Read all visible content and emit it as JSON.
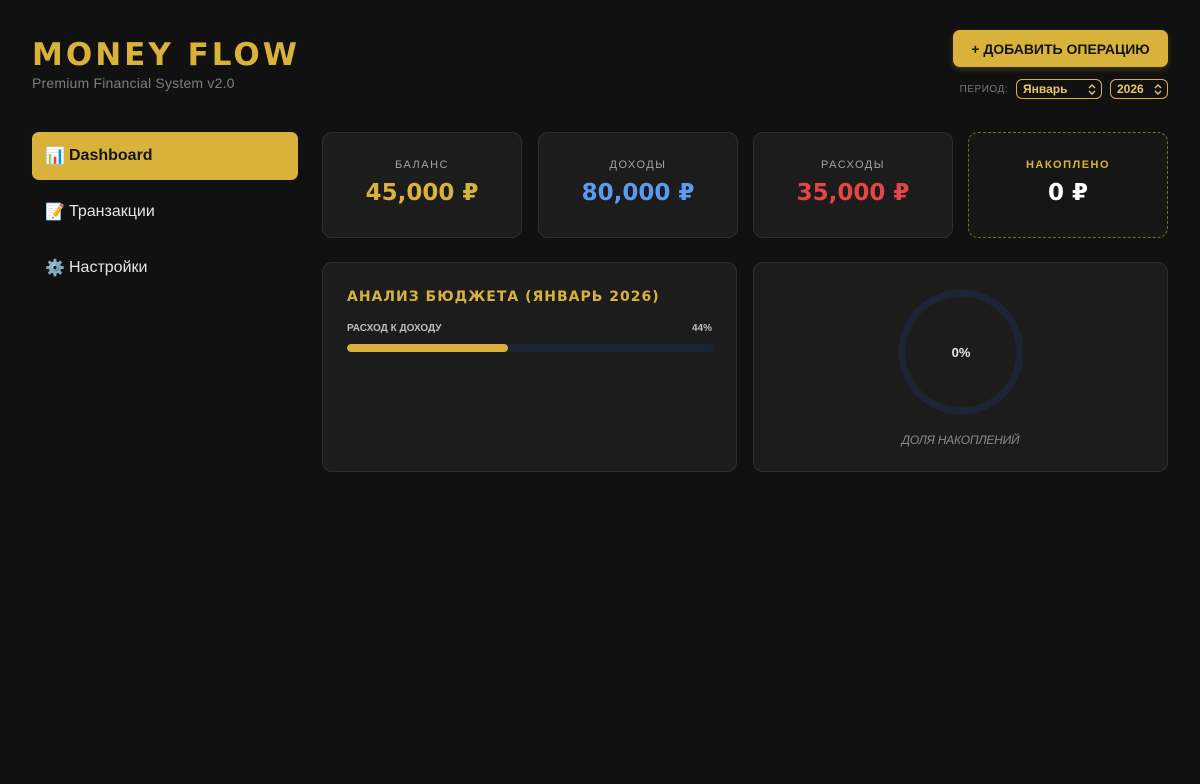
{
  "header": {
    "title": "MONEY FLOW",
    "subtitle": "Premium Financial System v2.0",
    "add_button_label": "+ ДОБАВИТЬ ОПЕРАЦИЮ",
    "period_label": "ПЕРИОД:",
    "month_selected": "Январь",
    "year_selected": "2026"
  },
  "sidebar": {
    "items": [
      {
        "icon": "📊",
        "icon_name": "bar-chart-icon",
        "label": "Dashboard",
        "active": true
      },
      {
        "icon": "📝",
        "icon_name": "memo-icon",
        "label": "Транзакции",
        "active": false
      },
      {
        "icon": "⚙️",
        "icon_name": "gear-icon",
        "label": "Настройки",
        "active": false
      }
    ]
  },
  "stats": {
    "balance": {
      "label": "БАЛАНС",
      "value": "45,000 ₽",
      "color": "#d8b23a"
    },
    "income": {
      "label": "ДОХОДЫ",
      "value": "80,000 ₽",
      "color": "#5b9cf0"
    },
    "expense": {
      "label": "РАСХОДЫ",
      "value": "35,000 ₽",
      "color": "#e64545"
    },
    "savings": {
      "label": "НАКОПЛЕНО",
      "value": "0 ₽",
      "color": "#ffffff"
    }
  },
  "budget": {
    "title": "АНАЛИЗ БЮДЖЕТА (ЯНВАРЬ 2026)",
    "ratio_label": "РАСХОД К ДОХОДУ",
    "ratio_text": "44%",
    "ratio_percent": 44
  },
  "share": {
    "percent_text": "0%",
    "percent": 0,
    "caption": "ДОЛЯ НАКОПЛЕНИЙ"
  },
  "colors": {
    "accent": "#d8b23a",
    "background": "#111111",
    "card": "#1c1c1c",
    "track": "#1d2436"
  }
}
